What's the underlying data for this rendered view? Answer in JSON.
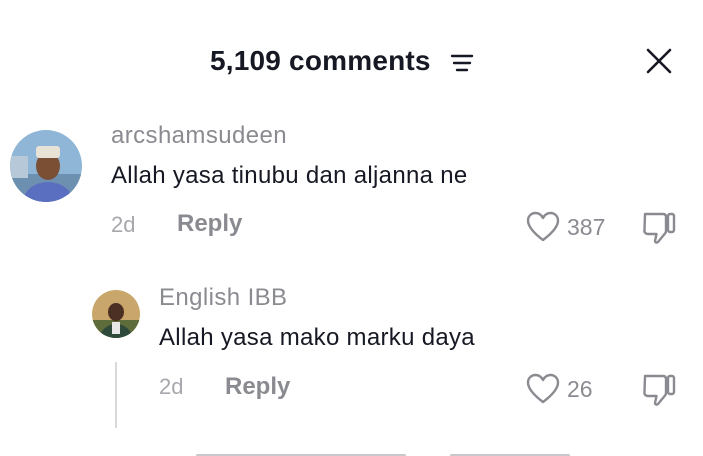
{
  "header": {
    "title": "5,109 comments",
    "filter_icon": "filter-sort-icon",
    "close_icon": "close-icon"
  },
  "comments": [
    {
      "username": "arcshamsudeen",
      "text": "Allah yasa tinubu dan aljanna ne",
      "time": "2d",
      "reply_label": "Reply",
      "likes": "387"
    },
    {
      "username": "English IBB",
      "text": "Allah yasa mako marku daya",
      "time": "2d",
      "reply_label": "Reply",
      "likes": "26"
    }
  ],
  "colors": {
    "text_primary": "#161823",
    "text_secondary": "#8a8b91",
    "background": "#ffffff"
  }
}
